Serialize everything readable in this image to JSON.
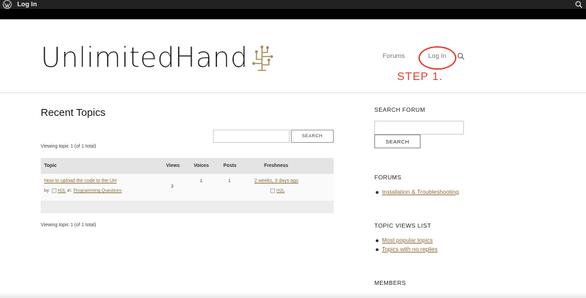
{
  "adminbar": {
    "login_label": "Log In"
  },
  "header": {
    "logo_text": "UnlimitedHand",
    "nav": {
      "forums": "Forums",
      "login": "Log In"
    },
    "annotation": "STEP 1.",
    "annotation_color": "#e53b2c"
  },
  "main": {
    "title": "Recent Topics",
    "search_button": "SEARCH",
    "viewing_text": "Viewing topic 1 (of 1 total)",
    "columns": [
      "Topic",
      "Views",
      "Voices",
      "Posts",
      "Freshness"
    ],
    "rows": [
      {
        "title": "How to upload the code to the UH",
        "by_label": "by:",
        "author": "H2L",
        "in_label": "in:",
        "forum": "Programming Questions",
        "views": "3",
        "voices": "1",
        "posts": "1",
        "freshness": "2 weeks, 3 days ago",
        "fresh_user": "H2L"
      }
    ]
  },
  "sidebar": {
    "search_heading": "SEARCH FORUM",
    "search_button": "SEARCH",
    "forums_heading": "FORUMS",
    "forums": [
      "Installation & Troubleshooting"
    ],
    "views_heading": "TOPIC VIEWS LIST",
    "views": [
      "Most popular topics",
      "Topics with no replies"
    ],
    "members_heading": "MEMBERS"
  },
  "colors": {
    "link": "#8a6d3b",
    "adminbar": "#222222",
    "accent_red": "#e53b2c"
  }
}
